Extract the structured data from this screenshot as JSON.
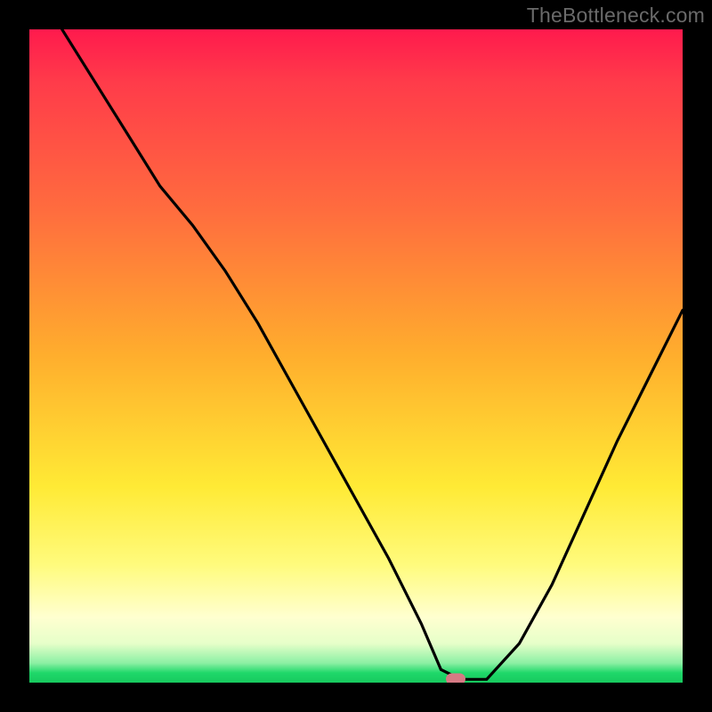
{
  "watermark": "TheBottleneck.com",
  "chart_data": {
    "type": "line",
    "title": "",
    "xlabel": "",
    "ylabel": "",
    "xlim": [
      0,
      100
    ],
    "ylim": [
      0,
      100
    ],
    "grid": false,
    "marker": {
      "x": 65.2,
      "y": 0.5
    },
    "series": [
      {
        "name": "curve",
        "x": [
          5,
          10,
          15,
          20,
          25,
          30,
          35,
          40,
          45,
          50,
          55,
          60,
          63,
          66,
          70,
          75,
          80,
          85,
          90,
          95,
          100
        ],
        "y": [
          100,
          92,
          84,
          76,
          70,
          63,
          55,
          46,
          37,
          28,
          19,
          9,
          2,
          0.5,
          0.5,
          6,
          15,
          26,
          37,
          47,
          57
        ]
      }
    ],
    "note": "x/y in percent of plot area; y measured from bottom (0) to top (100)",
    "colors": {
      "background_black": "#000000",
      "curve": "#000000",
      "marker": "#d67a84",
      "gradient_top": "#ff1a4d",
      "gradient_mid": "#ffea35",
      "gradient_bottom": "#17c95e"
    }
  }
}
